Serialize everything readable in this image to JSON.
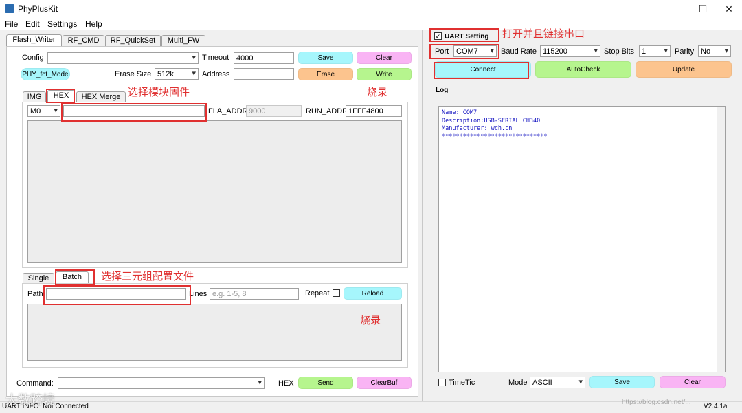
{
  "window": {
    "title": "PhyPlusKit",
    "version": "V2.4.1a"
  },
  "menu": [
    "File",
    "Edit",
    "Settings",
    "Help"
  ],
  "main_tabs": [
    "Flash_Writer",
    "RF_CMD",
    "RF_QuickSet",
    "Multi_FW"
  ],
  "config": {
    "label": "Config",
    "value": "",
    "timeout_label": "Timeout",
    "timeout_value": "4000",
    "save": "Save",
    "clear": "Clear"
  },
  "phy_mode": "PHY_fct_Mode",
  "erase": {
    "label": "Erase Size",
    "value": "512k",
    "address_label": "Address",
    "address_value": "",
    "erase_btn": "Erase",
    "write_btn": "Write"
  },
  "hex_tabs": [
    "IMG",
    "HEX",
    "HEX Merge"
  ],
  "hex": {
    "mode": "M0",
    "path": "|",
    "fla_label": "FLA_ADDR",
    "fla_value": "9000",
    "run_label": "RUN_ADDR",
    "run_value": "1FFF4800"
  },
  "batch_tabs": [
    "Single",
    "Batch"
  ],
  "batch": {
    "path_label": "Path",
    "path_value": "",
    "lines_label": "Lines",
    "lines_placeholder": "e.g. 1-5, 8",
    "repeat_label": "Repeat",
    "reload": "Reload"
  },
  "command": {
    "label": "Command:",
    "value": "",
    "hex_label": "HEX",
    "send": "Send",
    "clearbuf": "ClearBuf"
  },
  "uart": {
    "setting_label": "UART Setting",
    "port_label": "Port",
    "port_value": "COM7",
    "baud_label": "Baud Rate",
    "baud_value": "115200",
    "stop_label": "Stop Bits",
    "stop_value": "1",
    "parity_label": "Parity",
    "parity_value": "No",
    "connect": "Connect",
    "autocheck": "AutoCheck",
    "update": "Update"
  },
  "log": {
    "title": "Log",
    "lines": [
      "Name: COM7",
      "Description:USB-SERIAL CH340",
      "Manufacturer: wch.cn",
      "******************************"
    ]
  },
  "bottom_right": {
    "timetic_label": "TimeTic",
    "mode_label": "Mode",
    "mode_value": "ASCII",
    "save": "Save",
    "clear": "Clear"
  },
  "status": {
    "text": "UART INFO: Not Connected"
  },
  "annotations": {
    "open_port": "打开并且链接串口",
    "select_firmware": "选择模块固件",
    "burn1": "烧录",
    "select_config": "选择三元组配置文件",
    "burn2": "烧录"
  },
  "watermark": {
    "left": "大数跨境",
    "right": "https://blog.csdn.net/..."
  },
  "colors": {
    "save": "#a6f6fc",
    "clear": "#f9b4f4",
    "erase": "#fcc48e",
    "write": "#b6f58e",
    "connect": "#a6f6fc",
    "autocheck": "#b6f58e",
    "update": "#fcc48e",
    "annotation": "#e03030"
  }
}
